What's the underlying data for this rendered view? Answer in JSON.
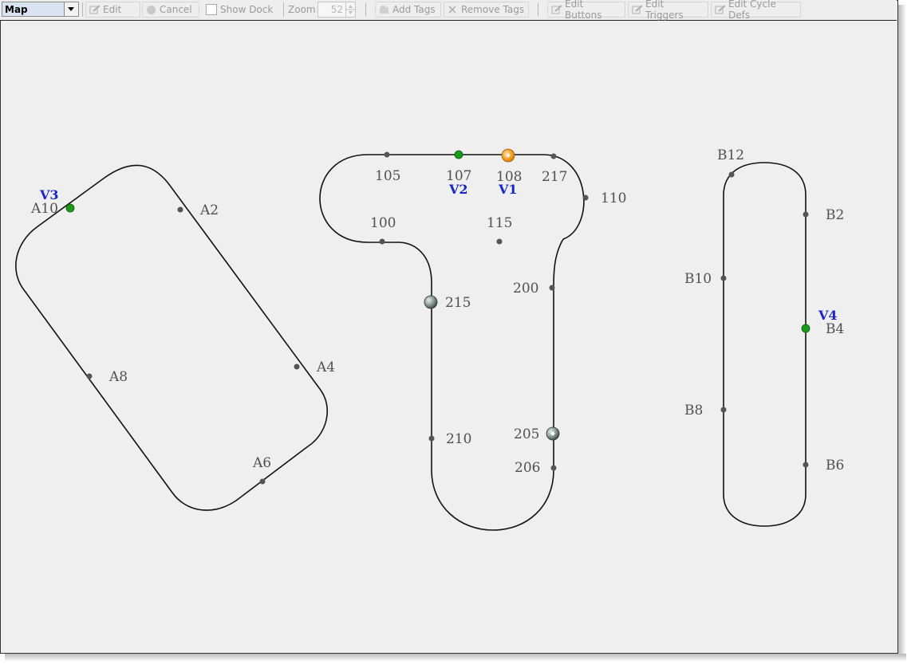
{
  "toolbar": {
    "view_selector": "Map",
    "edit_label": "Edit",
    "cancel_label": "Cancel",
    "show_dock_label": "Show Dock",
    "zoom_label": "Zoom",
    "zoom_value": "52",
    "add_tags_label": "Add Tags",
    "remove_tags_label": "Remove Tags",
    "edit_buttons_label": "Edit Buttons",
    "edit_triggers_label": "Edit Triggers",
    "edit_cycle_defs_label": "Edit Cycle Defs"
  },
  "map": {
    "loop_a_tags": [
      "A2",
      "A4",
      "A6",
      "A8",
      "A10"
    ],
    "loop_center_tags": [
      "105",
      "107",
      "108",
      "217",
      "110",
      "100",
      "115",
      "200",
      "215",
      "210",
      "205",
      "206"
    ],
    "loop_b_tags": [
      "B12",
      "B2",
      "B10",
      "B4",
      "B8",
      "B6"
    ],
    "vehicles": [
      "V1",
      "V2",
      "V3",
      "V4"
    ],
    "colors": {
      "track": "#111111",
      "tag_dot": "#555555",
      "vehicle_green": "#1a9a1a",
      "vehicle_orange": "#f29a1e",
      "vehicle_label": "#1a27c8"
    }
  }
}
